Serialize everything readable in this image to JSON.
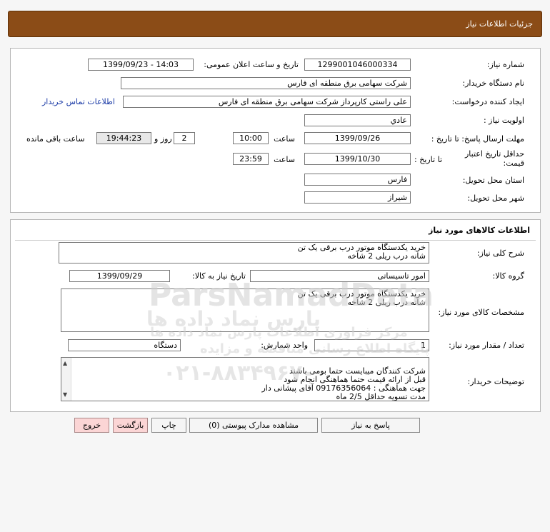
{
  "header": {
    "title": "جزئیات اطلاعات نیاز"
  },
  "general": {
    "need_number_label": "شماره نیاز:",
    "need_number": "1299001046000334",
    "announce_label": "تاریخ و ساعت اعلان عمومی:",
    "announce_value": "1399/09/23 - 14:03",
    "buyer_org_label": "نام دستگاه خریدار:",
    "buyer_org": "شرکت سهامی برق منطقه ای فارس",
    "creator_label": "ایجاد کننده درخواست:",
    "creator": "علی راستی کارپرداز شرکت سهامی برق منطقه ای فارس",
    "contact_link": "اطلاعات تماس خریدار",
    "priority_label": "اولویت نیاز :",
    "priority": "عادي",
    "deadline_label": "مهلت ارسال پاسخ: تا تاریخ :",
    "deadline_date": "1399/09/26",
    "time_label": "ساعت",
    "deadline_time": "10:00",
    "days_count": "2",
    "days_label": "روز و",
    "remaining_time": "19:44:23",
    "remaining_label": "ساعت باقی مانده",
    "validity_label_line1": "حداقل تاریخ اعتبار",
    "validity_label_line2": "قیمت:",
    "validity_until_label": "تا تاریخ :",
    "validity_date": "1399/10/30",
    "validity_time_label": "ساعت",
    "validity_time": "23:59",
    "province_label": "استان محل تحویل:",
    "province": "فارس",
    "city_label": "شهر محل تحویل:",
    "city": "شیراز"
  },
  "goods": {
    "section_title": "اطلاعات کالاهای مورد نیاز",
    "description_label": "شرح کلی نیاز:",
    "description": "خرید یکدستگاه موتور درب برقی یک تن\nشانه درب ریلی 2 شاخه",
    "group_label": "گروه کالا:",
    "group": "امور تاسیساتی",
    "need_date_label": "تاریخ نیاز به کالا:",
    "need_date": "1399/09/29",
    "specs_label": "مشخصات کالای مورد نیاز:",
    "specs": "خرید یکدستگاه موتور درب برقی یک تن\nشانه درب ریلی 2 شاخه",
    "quantity_label": "تعداد / مقدار مورد نیاز:",
    "quantity": "1",
    "unit_label": "واحد شمارش:",
    "unit": "دستگاه",
    "buyer_notes_label": "توضیحات خریدار:",
    "buyer_notes": "شرکت کنندگان میبایست حتما بومی باشند\nقبل از ارائه قیمت حتما هماهنگی انجام شود\nجهت هماهنگی : 09176356064 آقای پیشانی دار\nمدت تسویه حداقل 2/5 ماه"
  },
  "buttons": {
    "reply": "پاسخ به نیاز",
    "attachments": "مشاهده مدارک پیوستی (0)",
    "print": "چاپ",
    "back": "بازگشت",
    "exit": "خروج"
  },
  "watermark": {
    "latin": "ParsNamadData",
    "persian_line1": "پارس نماد داده ها",
    "persian_line2": "مرکز فراوری اطلاعات پارس نماد داده ها",
    "persian_line3": "پایگاه اطلاع رسانی مناقصه و مزایده",
    "phone": "۰۲۱-۸۸۳۴۹۶۷۰"
  },
  "colors": {
    "header_bg": "#8b4c17",
    "link": "#1a3aa6",
    "exit_bg": "#fbd5d5"
  }
}
